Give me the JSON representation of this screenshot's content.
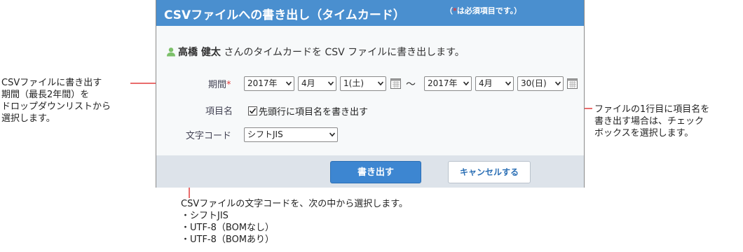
{
  "dialog": {
    "title": "CSVファイルへの書き出し（タイムカード）",
    "required_note_open": "（",
    "required_star": "*",
    "required_note_rest": "は必須項目です。）",
    "user_name": "高橋 健太",
    "user_suffix": " さんのタイムカードを CSV ファイルに書き出します。"
  },
  "form": {
    "period_label": "期間",
    "required_star": "*",
    "start_year": "2017年",
    "start_month": "4月",
    "start_day": "1(土)",
    "range_sep": "～",
    "end_year": "2017年",
    "end_month": "4月",
    "end_day": "30(日)",
    "header_label": "項目名",
    "header_check_label": "先頭行に項目名を書き出す",
    "header_checked": true,
    "encoding_label": "文字コード",
    "encoding_value": "シフトJIS"
  },
  "buttons": {
    "export": "書き出す",
    "cancel": "キャンセルする"
  },
  "annotations": {
    "period": "CSVファイルに書き出す\n期間（最長2年間）を\nドロップダウンリストから\n選択します。",
    "header": "ファイルの1行目に項目名を\n書き出す場合は、チェック\nボックスを選択します。",
    "encoding": "CSVファイルの文字コードを、次の中から選択します。\n・シフトJIS\n・UTF-8（BOMなし）\n・UTF-8（BOMあり）"
  },
  "colors": {
    "title_bar": "#4a8fcf",
    "primary_button": "#3d86d1",
    "required_star": "#e23b3b",
    "annotation_line": "#e23b3b",
    "footer": "#dde3ea"
  }
}
